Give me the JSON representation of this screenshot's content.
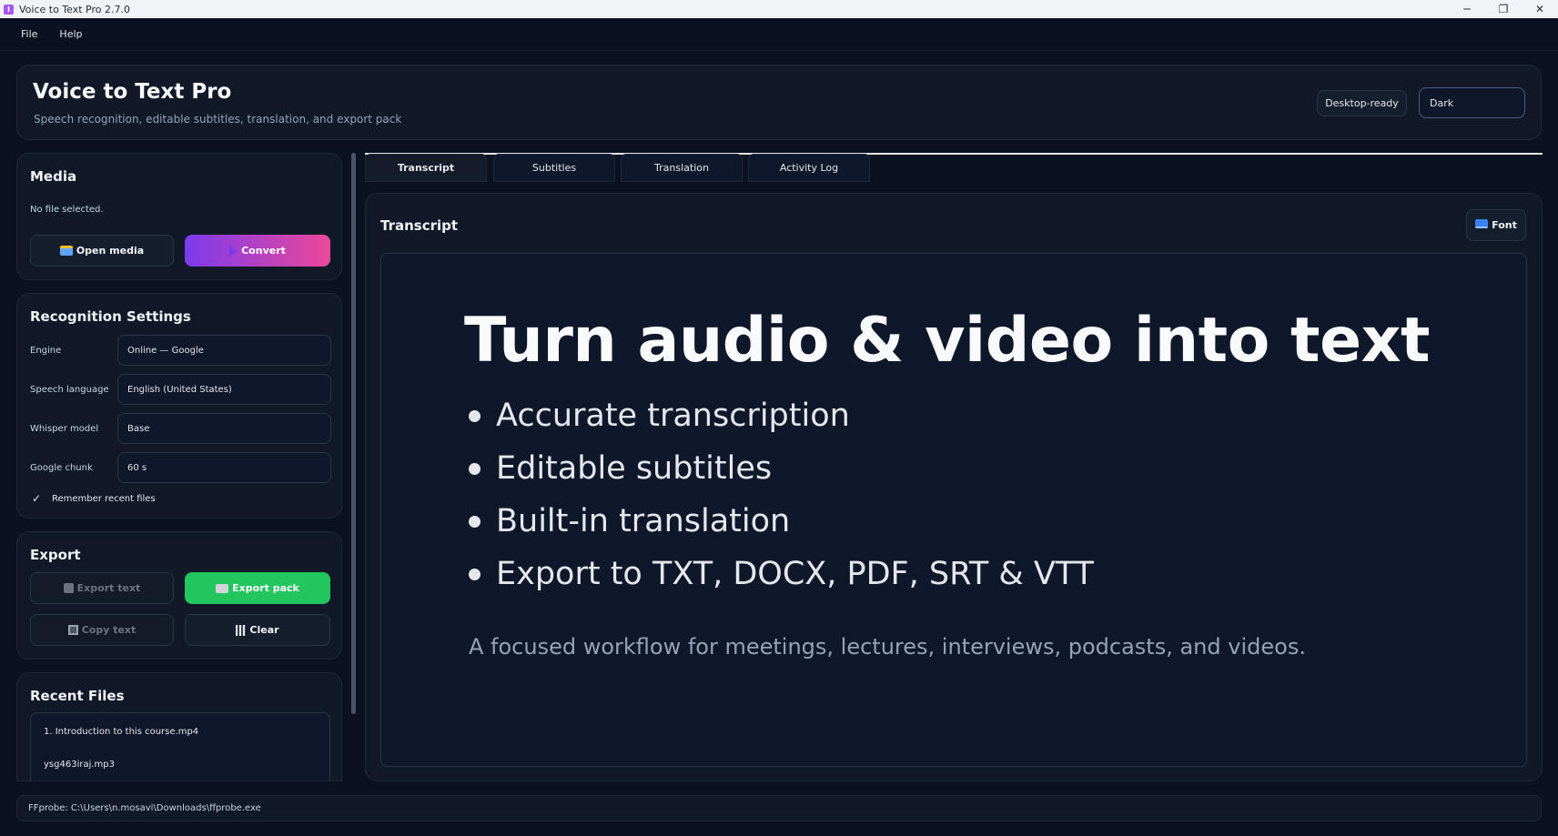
{
  "window": {
    "title": "Voice to Text Pro 2.7.0",
    "controls": {
      "minimize": "─",
      "restore": "❐",
      "close": "✕"
    }
  },
  "menu": {
    "items": [
      "File",
      "Help"
    ]
  },
  "header": {
    "title": "Voice to Text Pro",
    "subtitle": "Speech recognition, editable subtitles, translation, and export pack",
    "badge": "Desktop-ready",
    "theme": "Dark"
  },
  "media": {
    "title": "Media",
    "status": "No file selected.",
    "open_label": "Open media",
    "convert_label": "Convert"
  },
  "settings": {
    "title": "Recognition Settings",
    "rows": [
      {
        "label": "Engine",
        "value": "Online — Google"
      },
      {
        "label": "Speech language",
        "value": "English (United States)"
      },
      {
        "label": "Whisper model",
        "value": "Base"
      },
      {
        "label": "Google chunk",
        "value": "60 s"
      }
    ],
    "remember": {
      "checked": true,
      "check_glyph": "✓",
      "label": "Remember recent files"
    }
  },
  "export": {
    "title": "Export",
    "export_text": "Export text",
    "export_pack": "Export pack",
    "copy_text": "Copy text",
    "clear": "Clear"
  },
  "recent": {
    "title": "Recent Files",
    "items": [
      "1. Introduction to this course.mp4",
      "ysg463iraj.mp3"
    ]
  },
  "tabs": [
    {
      "label": "Transcript",
      "active": true
    },
    {
      "label": "Subtitles",
      "active": false
    },
    {
      "label": "Translation",
      "active": false
    },
    {
      "label": "Activity Log",
      "active": false
    }
  ],
  "transcript": {
    "title": "Transcript",
    "font_label": "Font",
    "hero": "Turn audio & video into text",
    "bullets": [
      "Accurate transcription",
      "Editable subtitles",
      "Built-in translation",
      "Export to TXT, DOCX, PDF, SRT & VTT"
    ],
    "tagline": "A focused workflow for meetings, lectures, interviews, podcasts, and videos."
  },
  "status": {
    "text": "FFprobe: C:\\Users\\n.mosavi\\Downloads\\ffprobe.exe"
  },
  "colors": {
    "background": "#0b1120",
    "panel": "#111827",
    "accent_gradient_start": "#7c3aed",
    "accent_gradient_end": "#ec4899",
    "success": "#22c55e"
  }
}
